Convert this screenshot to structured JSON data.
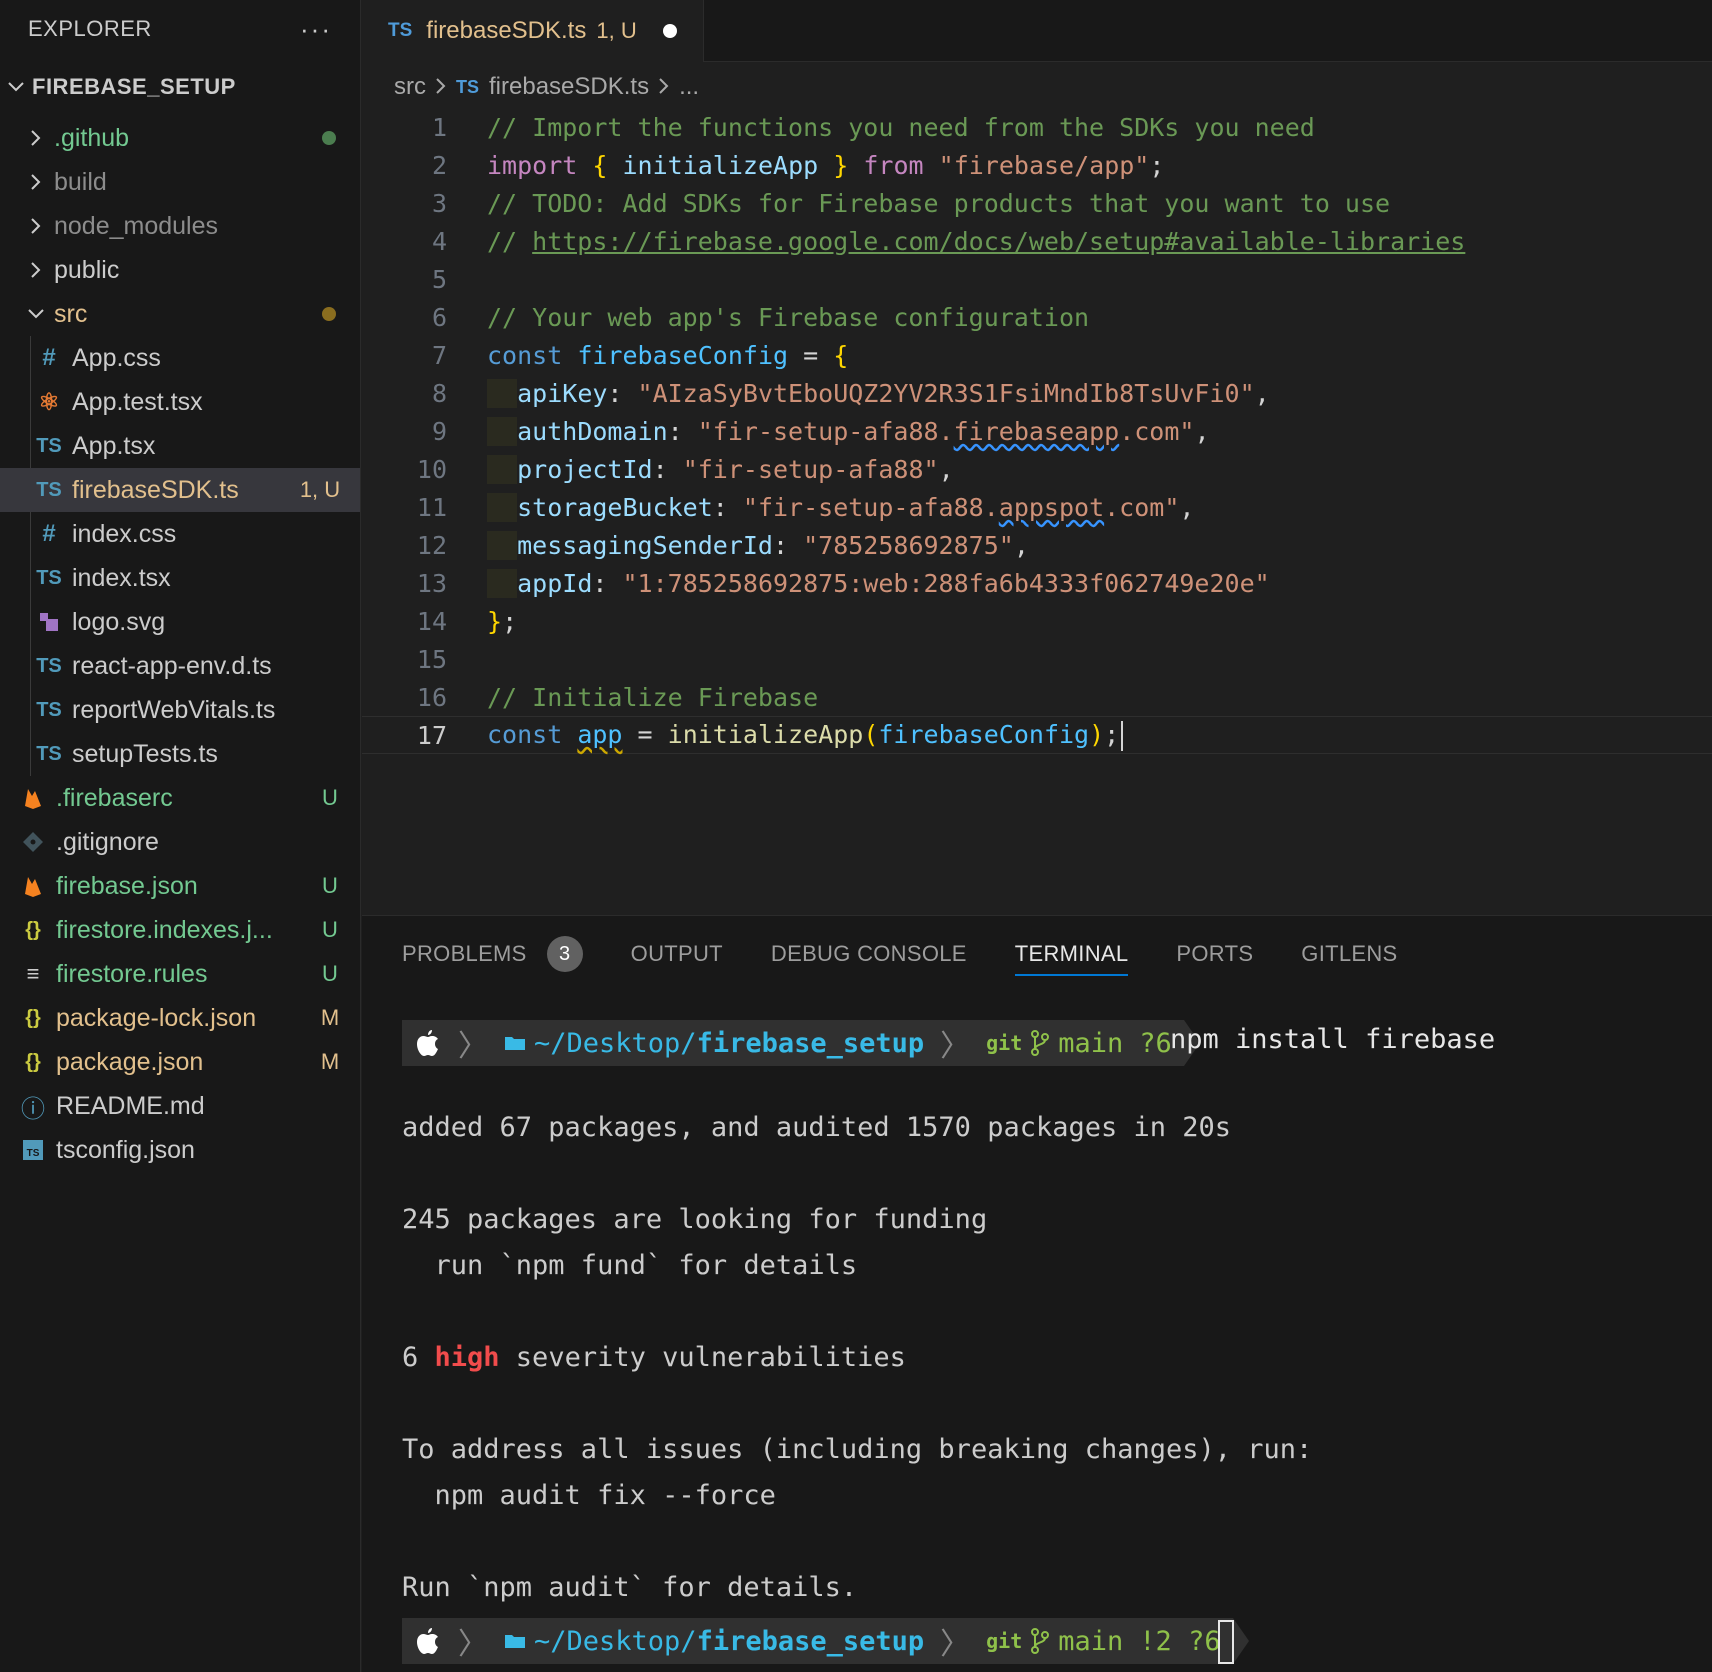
{
  "sidebar": {
    "title": "EXPLORER",
    "more": "···",
    "root": "FIREBASE_SETUP",
    "folders": [
      {
        "label": ".github",
        "color": "green",
        "dot": "#4b7d4f"
      },
      {
        "label": "build",
        "color": "dim"
      },
      {
        "label": "node_modules",
        "color": "dim"
      },
      {
        "label": "public",
        "color": "grey"
      }
    ],
    "src": {
      "label": "src",
      "dot": "#8a6d1f"
    },
    "src_files": [
      {
        "icon": "#",
        "label": "App.css"
      },
      {
        "icon": "⚛",
        "label": "App.test.tsx"
      },
      {
        "icon": "TS",
        "label": "App.tsx"
      },
      {
        "icon": "TS",
        "label": "firebaseSDK.ts",
        "badge": "1, U"
      },
      {
        "icon": "#",
        "label": "index.css"
      },
      {
        "icon": "TS",
        "label": "index.tsx"
      },
      {
        "icon": "▚",
        "label": "logo.svg"
      },
      {
        "icon": "TS",
        "label": "react-app-env.d.ts"
      },
      {
        "icon": "TS",
        "label": "reportWebVitals.ts"
      },
      {
        "icon": "TS",
        "label": "setupTests.ts"
      }
    ],
    "root_files": [
      {
        "icon": "🔥",
        "label": ".firebaserc",
        "badge": "U"
      },
      {
        "icon": "◆",
        "label": ".gitignore",
        "badge": ""
      },
      {
        "icon": "🔥",
        "label": "firebase.json",
        "badge": "U"
      },
      {
        "icon": "{}",
        "label": "firestore.indexes.j...",
        "badge": "U"
      },
      {
        "icon": "≡",
        "label": "firestore.rules",
        "badge": "U"
      },
      {
        "icon": "{}",
        "label": "package-lock.json",
        "badge": "M"
      },
      {
        "icon": "{}",
        "label": "package.json",
        "badge": "M"
      },
      {
        "icon": "ⓘ",
        "label": "README.md",
        "badge": ""
      },
      {
        "icon": "TS",
        "label": "tsconfig.json",
        "badge": ""
      }
    ]
  },
  "editor": {
    "tab": {
      "icon": "TS",
      "label": "firebaseSDK.ts",
      "status": "1, U"
    },
    "breadcrumb": {
      "folder": "src",
      "icon": "TS",
      "file": "firebaseSDK.ts",
      "more": "..."
    },
    "line_numbers": [
      "1",
      "2",
      "3",
      "4",
      "5",
      "6",
      "7",
      "8",
      "9",
      "10",
      "11",
      "12",
      "13",
      "14",
      "15",
      "16",
      "17"
    ],
    "code": {
      "l1": "// Import the functions you need from the SDKs you need",
      "l2_kw": "import",
      "l2_open": "{",
      "l2_fn": "initializeApp",
      "l2_close": "}",
      "l2_from": "from",
      "l2_str": "\"firebase/app\"",
      "l2_end": ";",
      "l3": "// TODO: Add SDKs for Firebase products that you want to use",
      "l4_prefix": "// ",
      "l4_link": "https://firebase.google.com/docs/web/setup#available-libraries",
      "l6": "// Your web app's Firebase configuration",
      "l7_kw": "const",
      "l7_var": "firebaseConfig",
      "l7_eq": " = ",
      "l7_br": "{",
      "l8_key": "apiKey",
      "l8_val": "\"AIzaSyBvtEboUQZ2YV2R3S1FsiMndIb8TsUvFi0\"",
      "l9_key": "authDomain",
      "l9_val_a": "\"fir-setup-afa88.",
      "l9_val_b": "firebaseapp",
      "l9_val_c": ".com\"",
      "l10_key": "projectId",
      "l10_val": "\"fir-setup-afa88\"",
      "l11_key": "storageBucket",
      "l11_val_a": "\"fir-setup-afa88.",
      "l11_val_b": "appspot",
      "l11_val_c": ".com\"",
      "l12_key": "messagingSenderId",
      "l12_val": "\"785258692875\"",
      "l13_key": "appId",
      "l13_val": "\"1:785258692875:web:288fa6b4333f062749e20e\"",
      "l14_br": "}",
      "l14_end": ";",
      "l16": "// Initialize Firebase",
      "l17_kw": "const",
      "l17_var": "app",
      "l17_eq": " = ",
      "l17_fn": "initializeApp",
      "l17_po": "(",
      "l17_arg": "firebaseConfig",
      "l17_pc": ")",
      "l17_end": ";"
    }
  },
  "panel": {
    "tabs": [
      "PROBLEMS",
      "OUTPUT",
      "DEBUG CONSOLE",
      "TERMINAL",
      "PORTS",
      "GITLENS"
    ],
    "problems_count": "3",
    "active_tab": "TERMINAL",
    "prompt1": {
      "dir_prefix": "~/Desktop/",
      "dir_bold": "firebase_setup",
      "git_label": "git",
      "branch": "main",
      "status": "?6"
    },
    "command": "npm install firebase",
    "output": {
      "o1": "added 67 packages, and audited 1570 packages in 20s",
      "o2": "245 packages are looking for funding",
      "o3": "  run `npm fund` for details",
      "o4_a": "6 ",
      "o4_b": "high",
      "o4_c": " severity vulnerabilities",
      "o5": "To address all issues (including breaking changes), run:",
      "o6": "  npm audit fix --force",
      "o7": "Run `npm audit` for details."
    },
    "prompt2": {
      "dir_prefix": "~/Desktop/",
      "dir_bold": "firebase_setup",
      "git_label": "git",
      "branch": "main",
      "status": "!2 ?6"
    }
  }
}
